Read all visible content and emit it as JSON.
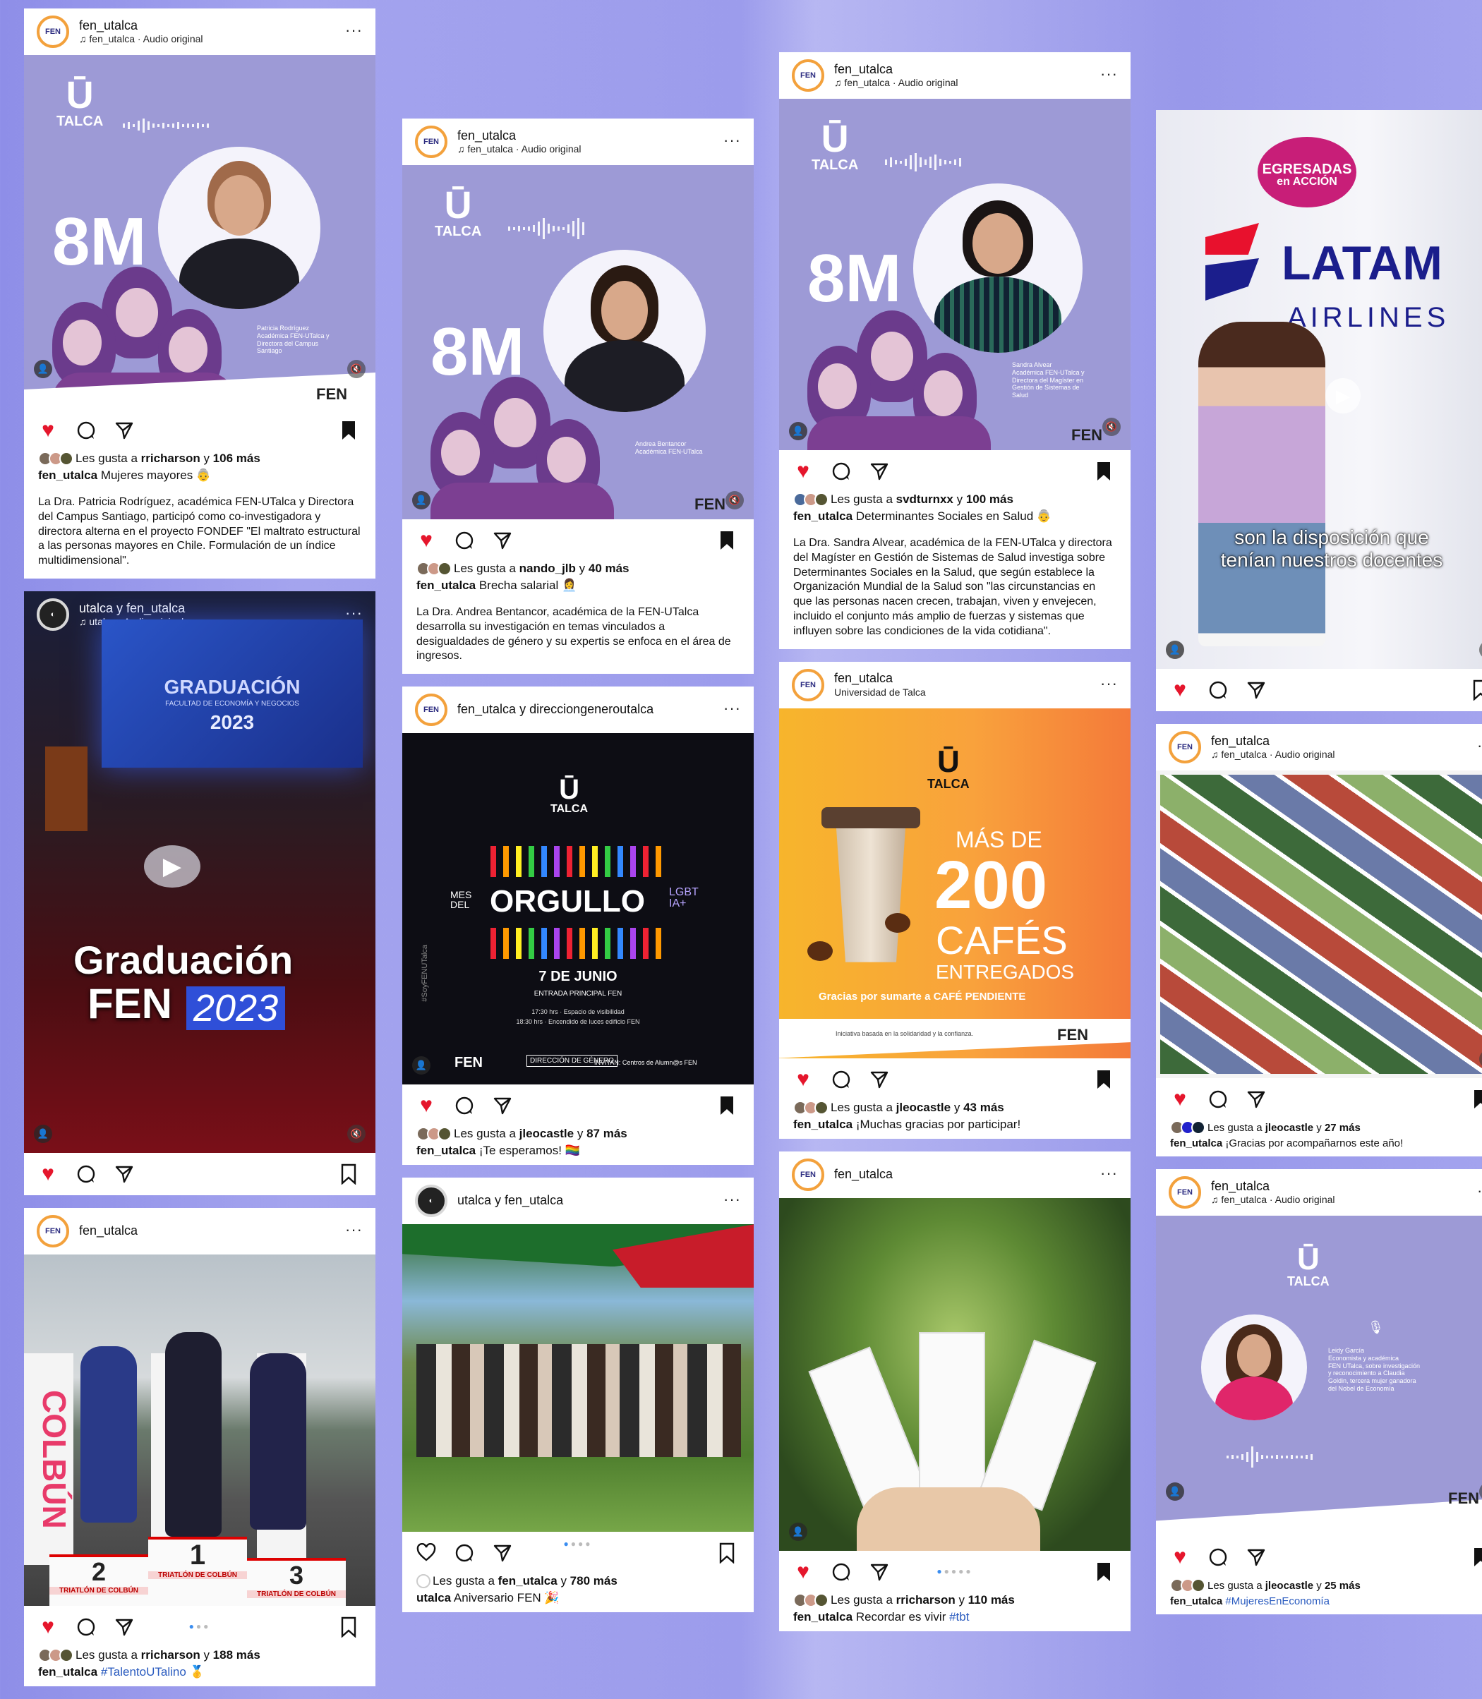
{
  "audio_original": "fen_utalca · Audio original",
  "posts": {
    "p1": {
      "user": "fen_utalca",
      "sub": "fen_utalca · Audio original",
      "big": "8M",
      "talca": "TALCA",
      "nametag": "Patricia Rodríguez\nAcadémica FEN-UTalca y\nDirectora del Campus\nSantiago",
      "fen": "FEN",
      "likes_pre": "Les gusta a ",
      "likes_user": "rricharson",
      "likes_post": " y ",
      "likes_count": "106 más",
      "cap_user": "fen_utalca",
      "cap_text": " Mujeres mayores 👵",
      "desc": "La Dra. Patricia Rodríguez, académica FEN-UTalca y Directora del Campus Santiago, participó como co-investigadora y directora alterna en el proyecto FONDEF \"El maltrato estructural a las personas mayores en Chile. Formulación de un índice multidimensional\"."
    },
    "p2": {
      "user": "utalca y fen_utalca",
      "sub": "utalca · Audio original",
      "t1": "GRADUACIÓN",
      "t2": "FACULTAD DE ECONOMÍA Y NEGOCIOS",
      "t3": "2023",
      "overlay1": "Graduación",
      "overlay2": "FEN",
      "overlay3": "2023"
    },
    "p3": {
      "user": "fen_utalca",
      "podium1": "2",
      "podium2": "1",
      "podium3": "3",
      "podium_text": "TRIATLÓN DE COLBÚN",
      "banner": "COLBÚN",
      "likes_pre": "Les gusta a ",
      "likes_user": "rricharson",
      "likes_post": " y ",
      "likes_count": "188 más",
      "cap_user": "fen_utalca",
      "cap_tag": "#TalentoUTalino",
      "cap_emoji": " 🥇"
    },
    "p4": {
      "user": "fen_utalca",
      "sub": "fen_utalca · Audio original",
      "big": "8M",
      "talca": "TALCA",
      "nametag": "Andrea Bentancor\nAcadémica FEN-UTalca",
      "fen": "FEN",
      "likes_pre": "Les gusta a ",
      "likes_user": "nando_jlb",
      "likes_post": " y ",
      "likes_count": "40 más",
      "cap_user": "fen_utalca",
      "cap_text": " Brecha salarial 👩‍💼",
      "desc": "La Dra. Andrea Bentancor, académica de la FEN-UTalca desarrolla su investigación en temas vinculados a desigualdades de género y su expertis se enfoca en el área de ingresos."
    },
    "p5": {
      "user": "fen_utalca y direcciongeneroutalca",
      "talca": "TALCA",
      "mes": "MES",
      "del": "DEL",
      "orgullo": "ORGULLO",
      "lgbt": "LGBT\nIA+",
      "date": "7 DE JUNIO",
      "place": "ENTRADA PRINCIPAL FEN",
      "line1": "17:30 hrs · Espacio de visibilidad",
      "line2": "18:30 hrs · Encendido de luces edificio FEN",
      "side": "#SoyFENUTalca",
      "foot1": "FEN",
      "foot2": "DIRECCIÓN DE GÉNERO",
      "foot3": "INVITAN: Centros de Alumn@s FEN",
      "likes_pre": "Les gusta a ",
      "likes_user": "jleocastle",
      "likes_post": " y ",
      "likes_count": "87 más",
      "cap_user": "fen_utalca",
      "cap_text": " ¡Te esperamos! 🏳️‍🌈"
    },
    "p6": {
      "user": "utalca y fen_utalca",
      "likes_pre": "Les gusta a ",
      "likes_user": "fen_utalca",
      "likes_post": " y ",
      "likes_count": "780 más",
      "cap_user": "utalca",
      "cap_text": " Aniversario FEN 🎉"
    },
    "p7": {
      "user": "fen_utalca",
      "sub": "fen_utalca · Audio original",
      "big": "8M",
      "talca": "TALCA",
      "nametag": "Sandra Alvear\nAcadémica FEN-UTalca y\nDirectora del Magíster en\nGestión de Sistemas de\nSalud",
      "fen": "FEN",
      "likes_pre": "Les gusta a ",
      "likes_user": "svdturnxx",
      "likes_post": " y ",
      "likes_count": "100 más",
      "cap_user": "fen_utalca",
      "cap_text": " Determinantes Sociales en Salud 👵",
      "desc": "La Dra. Sandra Alvear, académica de la FEN-UTalca y directora del Magíster en Gestión de Sistemas de Salud investiga sobre Determinantes Sociales en la Salud, que según establece la Organización Mundial de la Salud son \"las circunstancias en que las personas nacen crecen, trabajan, viven y envejecen, incluido el conjunto más amplio de fuerzas y sistemas que influyen sobre las condiciones de la vida cotidiana\"."
    },
    "p8": {
      "user": "fen_utalca",
      "sub": "Universidad de Talca",
      "talca": "TALCA",
      "mas": "MÁS DE",
      "num": "200",
      "cafes": "CAFÉS",
      "entregados": "ENTREGADOS",
      "gracias": "Gracias por sumarte a CAFÉ PENDIENTE",
      "foot": "Iniciativa basada en la solidaridad y la confianza.",
      "fen": "FEN",
      "likes_pre": "Les gusta a ",
      "likes_user": "jleocastle",
      "likes_post": " y ",
      "likes_count": "43 más",
      "cap_user": "fen_utalca",
      "cap_text": " ¡Muchas gracias por participar!"
    },
    "p9": {
      "user": "fen_utalca",
      "likes_pre": "Les gusta a ",
      "likes_user": "rricharson",
      "likes_post": " y ",
      "likes_count": "110 más",
      "cap_user": "fen_utalca",
      "cap_text": " Recordar es vivir ",
      "cap_tag": "#tbt"
    },
    "p10": {
      "badge1": "EGRESADAS",
      "badge2": "en ACCIÓN",
      "latam": "LATAM",
      "airlines": "AIRLINES",
      "subtitle1": "son la disposición que",
      "subtitle2": "tenían nuestros docentes"
    },
    "p11": {
      "user": "fen_utalca",
      "sub": "fen_utalca · Audio original",
      "likes_pre": "Les gusta a ",
      "likes_user": "jleocastle",
      "likes_post": " y ",
      "likes_count": "27 más",
      "cap_user": "fen_utalca",
      "cap_text": " ¡Gracias por acompañarnos este año!"
    },
    "p12": {
      "user": "fen_utalca",
      "sub": "fen_utalca · Audio original",
      "talca": "TALCA",
      "nametag": "Leidy García\nEconomista y académica\nFEN UTalca, sobre investigación\ny reconocimiento a Claudia\nGoldin, tercera mujer ganadora\ndel Nobel de Economía",
      "fen": "FEN",
      "likes_pre": "Les gusta a ",
      "likes_user": "jleocastle",
      "likes_post": " y ",
      "likes_count": "25 más",
      "cap_user": "fen_utalca",
      "cap_tag": " #MujeresEnEconomía"
    }
  },
  "colors": {
    "lavender": "#9d9ad6",
    "heart": "#e5162c",
    "tag_blue": "#2a5bbf",
    "accent_orange": "#f3a13c",
    "latam_blue": "#1b1e8c",
    "latam_red": "#e8112d"
  },
  "icons": [
    "heart-icon",
    "comment-icon",
    "share-icon",
    "bookmark-icon",
    "more-icon",
    "mute-icon",
    "user-tag-icon",
    "play-icon",
    "mic-icon"
  ]
}
